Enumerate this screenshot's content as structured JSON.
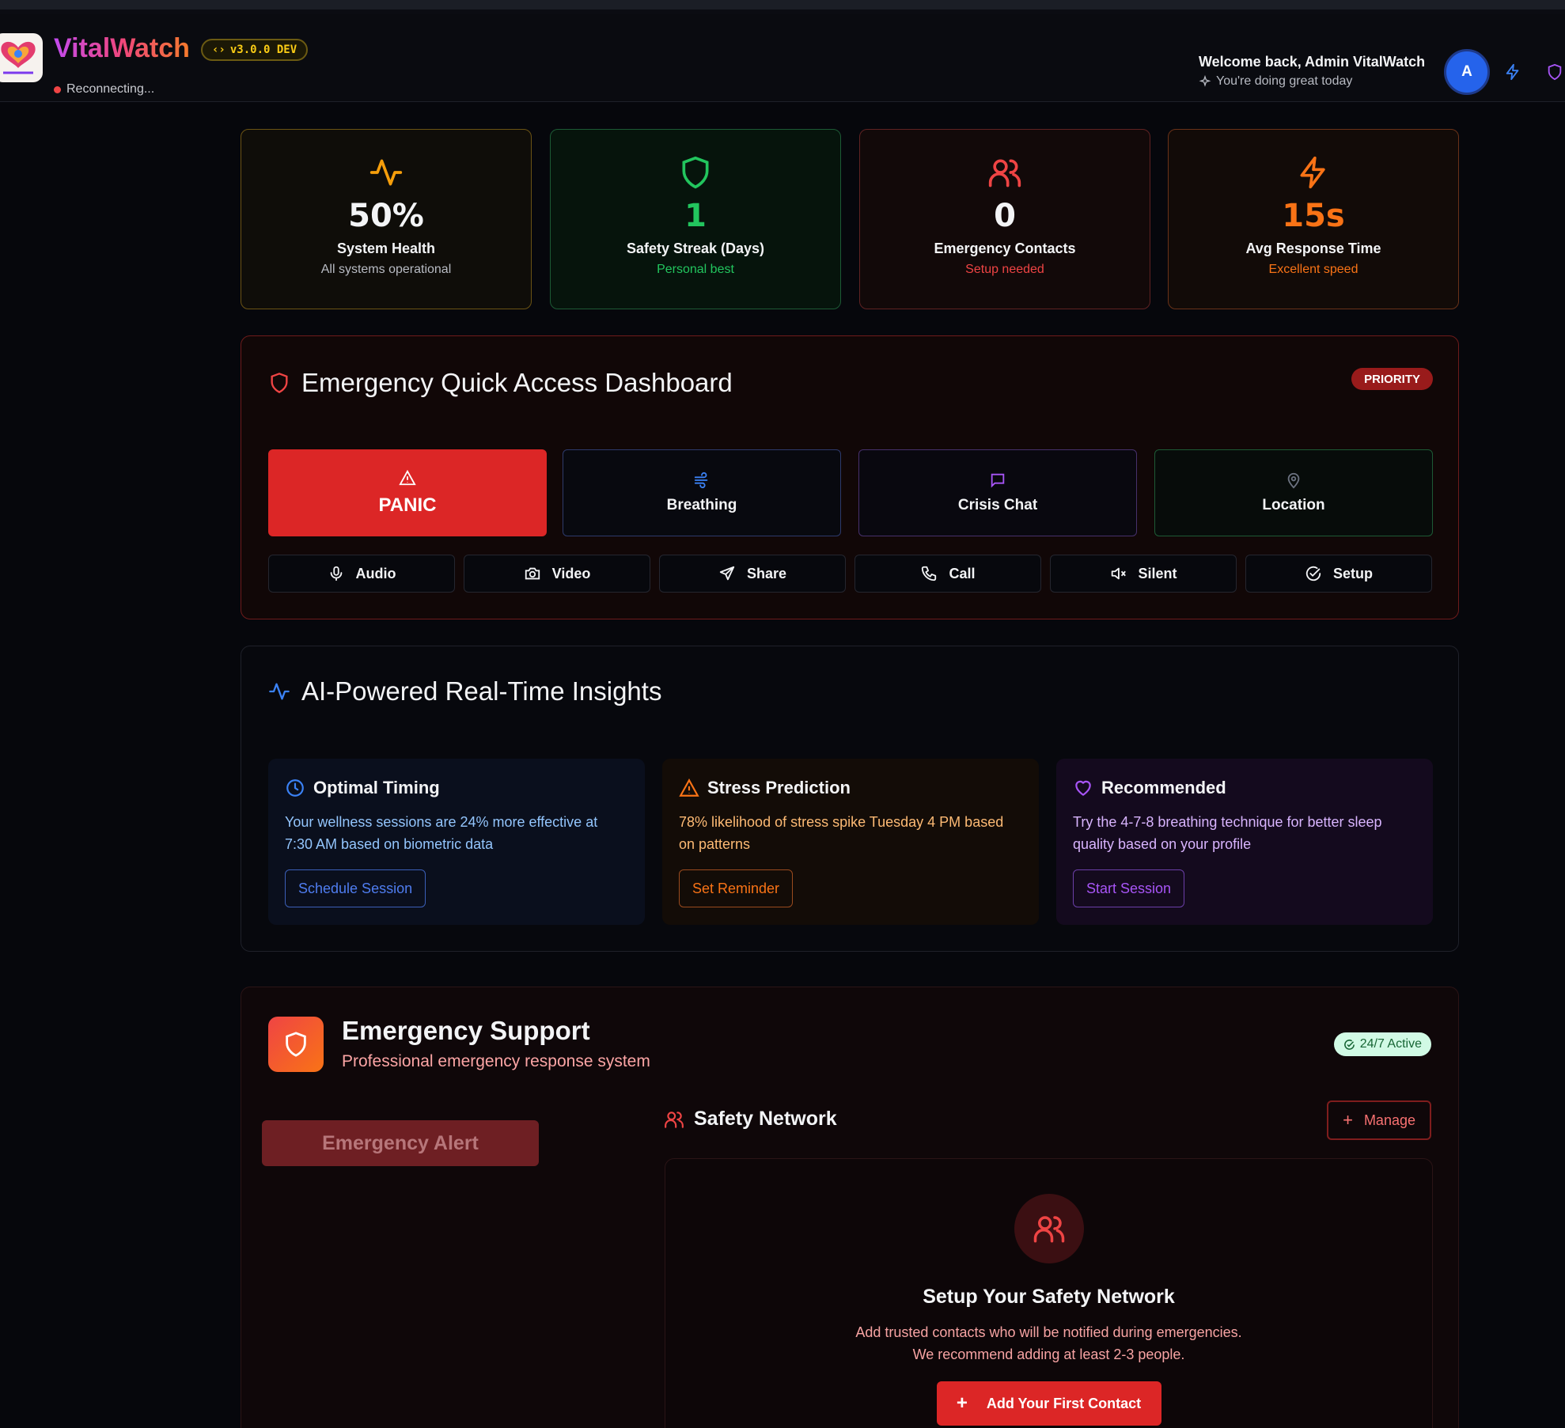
{
  "header": {
    "brand": "VitalWatch",
    "version": "v3.0.0 DEV",
    "status": "Reconnecting...",
    "welcome_title": "Welcome back, Admin VitalWatch",
    "welcome_sub": "You're doing great today",
    "avatar_initial": "A",
    "icons": [
      "sparkle-icon",
      "lightning-icon",
      "shield-icon"
    ]
  },
  "stats": [
    {
      "value": "50%",
      "label": "System Health",
      "sub": "All systems operational",
      "icon": "activity-icon",
      "accent": "#f59e0b"
    },
    {
      "value": "1",
      "label": "Safety Streak (Days)",
      "sub": "Personal best",
      "icon": "shield-icon",
      "accent": "#22c55e"
    },
    {
      "value": "0",
      "label": "Emergency Contacts",
      "sub": "Setup needed",
      "icon": "users-icon",
      "accent": "#ef4444"
    },
    {
      "value": "15s",
      "label": "Avg Response Time",
      "sub": "Excellent speed",
      "icon": "lightning-icon",
      "accent": "#f97316"
    }
  ],
  "quick_access": {
    "title": "Emergency Quick Access Dashboard",
    "badge": "PRIORITY",
    "primary_buttons": [
      {
        "label": "PANIC",
        "icon": "alert-triangle-icon"
      },
      {
        "label": "Breathing",
        "icon": "wind-icon"
      },
      {
        "label": "Crisis Chat",
        "icon": "message-icon"
      },
      {
        "label": "Location",
        "icon": "map-pin-icon"
      }
    ],
    "secondary_buttons": [
      {
        "label": "Audio",
        "icon": "mic-icon"
      },
      {
        "label": "Video",
        "icon": "camera-icon"
      },
      {
        "label": "Share",
        "icon": "send-icon"
      },
      {
        "label": "Call",
        "icon": "phone-icon"
      },
      {
        "label": "Silent",
        "icon": "volume-mute-icon"
      },
      {
        "label": "Setup",
        "icon": "check-circle-icon"
      }
    ]
  },
  "insights": {
    "title": "AI-Powered Real-Time Insights",
    "cards": [
      {
        "title": "Optimal Timing",
        "body": "Your wellness sessions are 24% more effective at 7:30 AM based on biometric data",
        "button": "Schedule Session",
        "icon": "clock-icon",
        "accent": "#3b82f6"
      },
      {
        "title": "Stress Prediction",
        "body": "78% likelihood of stress spike Tuesday 4 PM based on patterns",
        "button": "Set Reminder",
        "icon": "alert-triangle-icon",
        "accent": "#f97316"
      },
      {
        "title": "Recommended",
        "body": "Try the 4-7-8 breathing technique for better sleep quality based on your profile",
        "button": "Start Session",
        "icon": "heart-icon",
        "accent": "#a855f7"
      }
    ]
  },
  "support": {
    "title": "Emergency Support",
    "subtitle": "Professional emergency response system",
    "badge": "24/7 Active",
    "alert_button": "Emergency Alert",
    "network_title": "Safety Network",
    "manage_button": "Manage",
    "setup_title": "Setup Your Safety Network",
    "setup_line1": "Add trusted contacts who will be notified during emergencies.",
    "setup_line2": "We recommend adding at least 2-3 people.",
    "add_button": "Add Your First Contact"
  }
}
